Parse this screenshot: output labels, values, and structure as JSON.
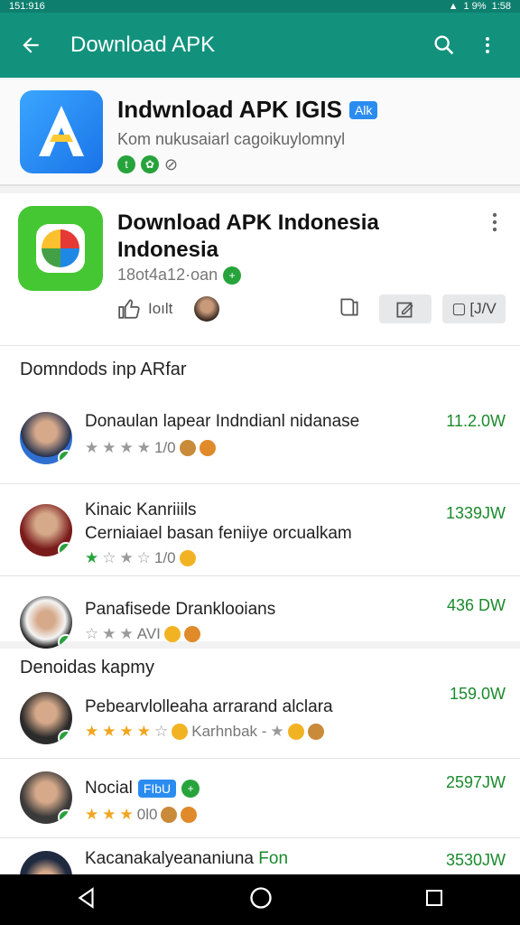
{
  "status": {
    "left": "151:916",
    "right": "1 9%",
    "time": "1:58"
  },
  "appbar": {
    "title": "Download APK"
  },
  "top_card": {
    "title": "Indwnload APK IGIS",
    "tag": "Alk",
    "subtitle": "Kom nukusaiarl cagoikuylomnyl"
  },
  "main_card": {
    "title_line1": "Download APK Indonesia",
    "title_line2": "Indonesia",
    "meta": "18ot4a12·oan",
    "action1": "Ioılt",
    "action_chip2": "[J/V"
  },
  "section1": {
    "header": "Domndods inp ARfar",
    "rows": [
      {
        "title": "Donaulan lapear Indndianl nidanase",
        "rating_text": "1/0",
        "value": "11.2.0W"
      },
      {
        "title": "Kinaic Kanriiils",
        "subtitle": "Cerniaiael basan feniiye orcualkam",
        "rating_text": "1/0",
        "value": "1339JW"
      },
      {
        "title": "Panafisede Dranklooians",
        "rating_text": "AVI",
        "value": "436 DW"
      }
    ]
  },
  "section2": {
    "header": "Denoidas kapmy",
    "rows": [
      {
        "title": "Pebearvlolleaha arrarand alclara",
        "rating_text": "Karhnbak -",
        "value": "159.0W"
      },
      {
        "title": "Nocial",
        "tag": "FIbU",
        "rating_text": "0l0",
        "value": "2597JW"
      },
      {
        "title": "Kacanakalyeananiuna",
        "tag": "Fon",
        "value": "3530JW"
      }
    ]
  },
  "colors": {
    "primary": "#12927d",
    "accent_green": "#1a8a2c",
    "star": "#f2a51e"
  }
}
